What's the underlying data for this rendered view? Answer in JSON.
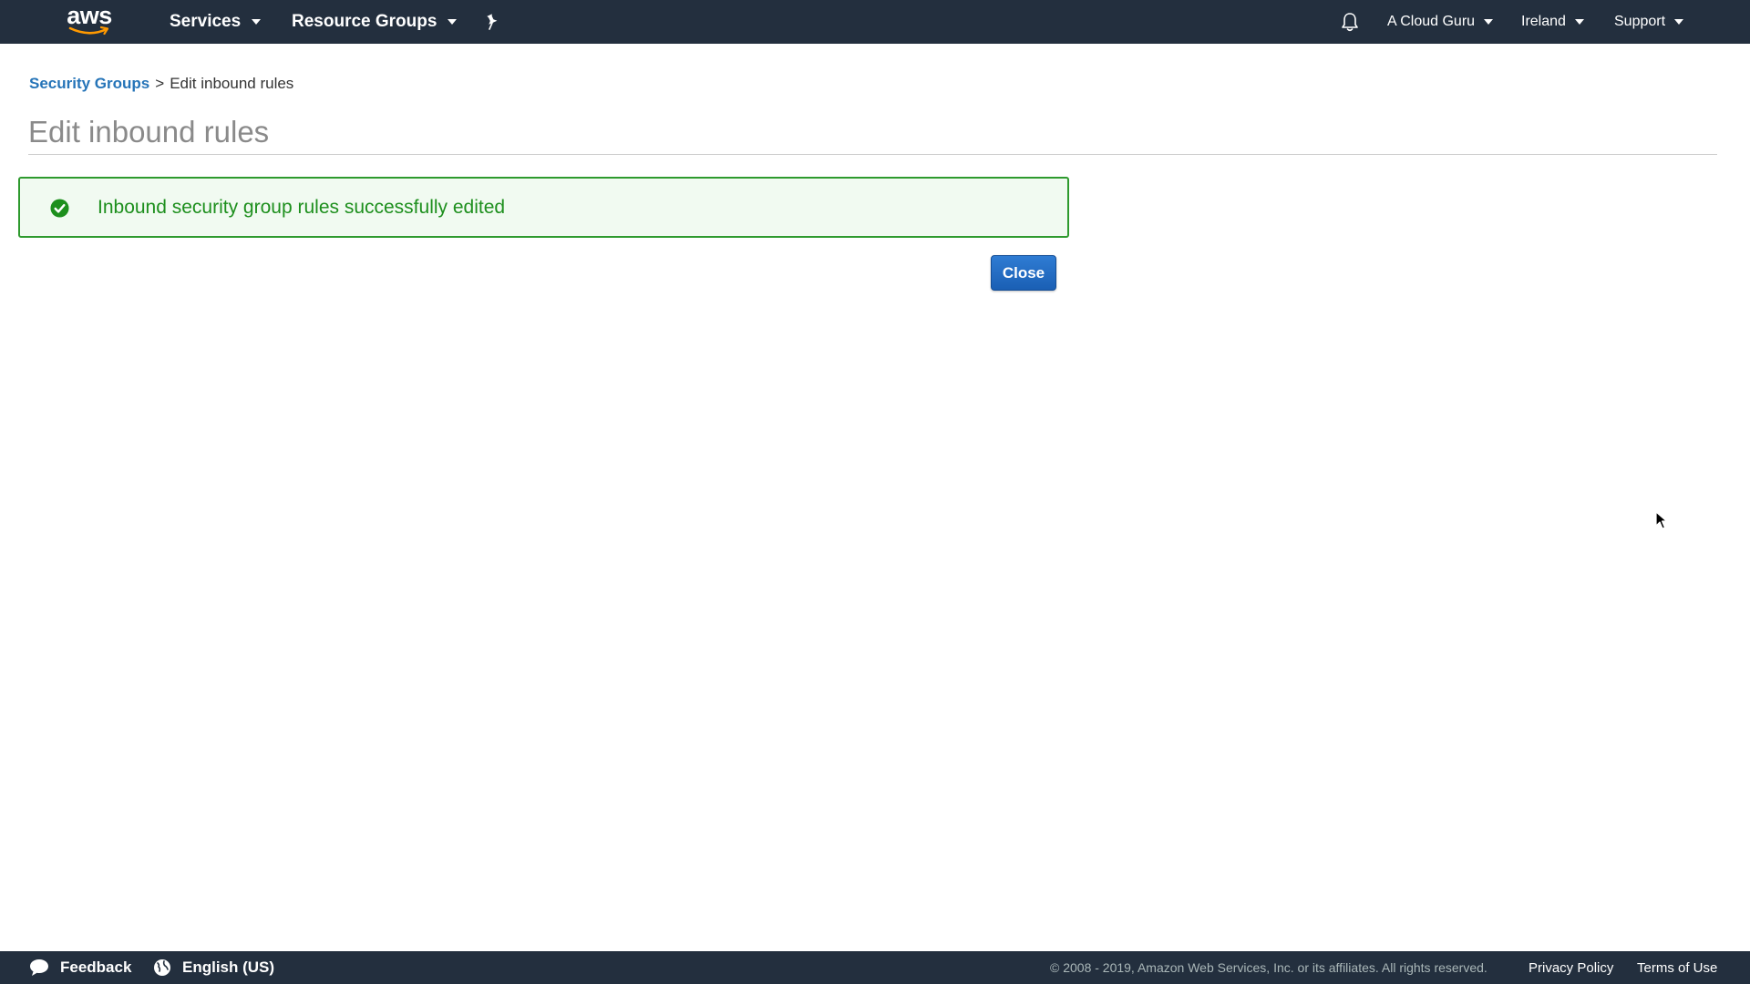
{
  "topnav": {
    "logo_text": "aws",
    "services_label": "Services",
    "resource_groups_label": "Resource Groups",
    "account_label": "A Cloud Guru",
    "region_label": "Ireland",
    "support_label": "Support",
    "background_color": "#232f3e",
    "icons": [
      "pin-icon",
      "bell-icon"
    ]
  },
  "breadcrumb": {
    "parent_label": "Security Groups",
    "separator": ">",
    "current_label": "Edit inbound rules"
  },
  "page": {
    "title": "Edit inbound rules"
  },
  "alert": {
    "message": "Inbound security group rules successfully edited",
    "type": "success",
    "color": "#1d8f1d"
  },
  "actions": {
    "close_label": "Close",
    "close_color": "#1a5fb4"
  },
  "footer": {
    "feedback_label": "Feedback",
    "language_label": "English (US)",
    "copyright": "© 2008 - 2019, Amazon Web Services, Inc. or its affiliates. All rights reserved.",
    "privacy_label": "Privacy Policy",
    "terms_label": "Terms of Use"
  }
}
